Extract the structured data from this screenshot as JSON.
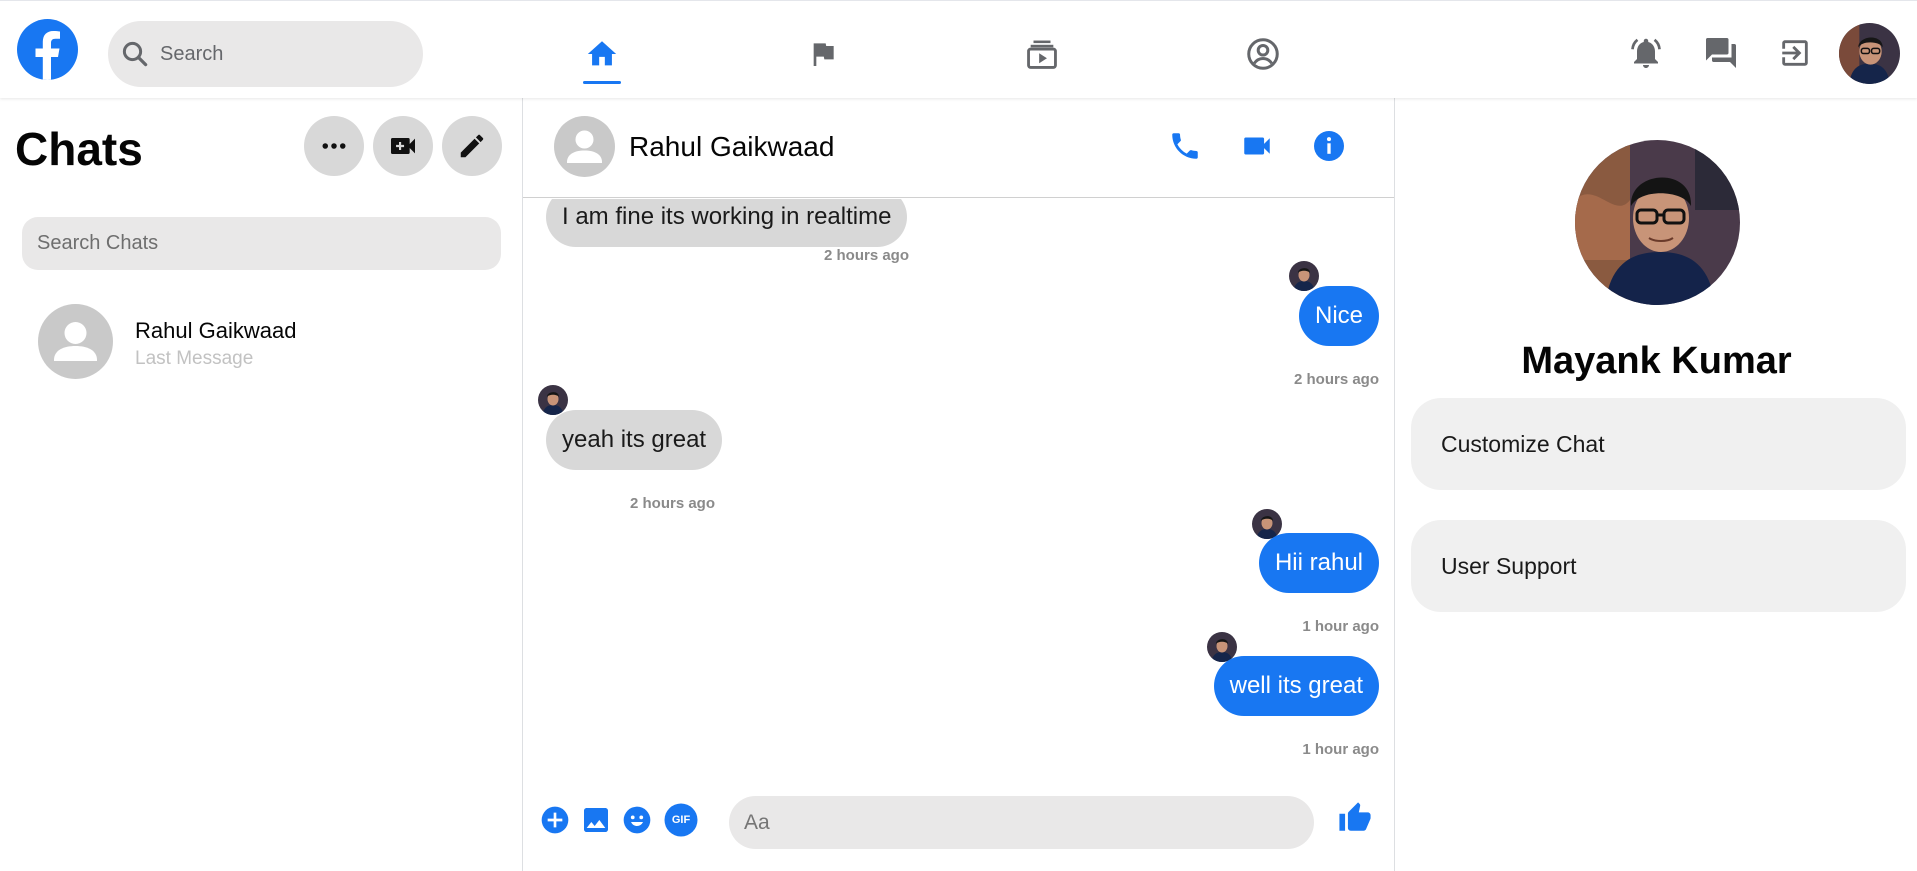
{
  "colors": {
    "accent": "#1877f2",
    "incoming_bubble": "#d8d8d8",
    "input_bg": "#e9e8e8",
    "option_bg": "#f0f0f0"
  },
  "topbar": {
    "logo_icon": "facebook-logo",
    "search": {
      "placeholder": "Search",
      "icon": "search-icon"
    },
    "tabs": [
      {
        "icon": "home-icon",
        "active": true
      },
      {
        "icon": "flag-icon",
        "active": false
      },
      {
        "icon": "watch-icon",
        "active": false
      },
      {
        "icon": "account-circle-icon",
        "active": false
      }
    ],
    "right_icons": [
      "notifications-icon",
      "messages-icon",
      "logout-icon",
      "user-avatar"
    ]
  },
  "sidebar": {
    "title": "Chats",
    "actions": [
      "more-options-icon",
      "video-call-icon",
      "edit-icon"
    ],
    "search_placeholder": "Search Chats",
    "chats": [
      {
        "name": "Rahul Gaikwaad",
        "subtitle": "Last Message"
      }
    ]
  },
  "conversation": {
    "contact_name": "Rahul Gaikwaad",
    "header_icons": [
      "phone-icon",
      "video-icon",
      "info-icon"
    ],
    "messages": [
      {
        "direction": "in",
        "text": "I am fine its working in realtime",
        "time": "2 hours ago"
      },
      {
        "direction": "out",
        "text": "Nice",
        "time": "2 hours ago"
      },
      {
        "direction": "in",
        "text": "yeah its great",
        "time": "2 hours ago"
      },
      {
        "direction": "out",
        "text": "Hii rahul",
        "time": "1 hour ago"
      },
      {
        "direction": "out",
        "text": "well its great",
        "time": "1 hour ago"
      }
    ],
    "composer": {
      "placeholder": "Aa",
      "icons": [
        "add-circle-icon",
        "image-icon",
        "emoji-icon",
        "gif-icon",
        "like-icon"
      ],
      "gif_label": "GIF"
    }
  },
  "profile": {
    "name": "Mayank Kumar",
    "options": [
      "Customize Chat",
      "User Support"
    ]
  }
}
